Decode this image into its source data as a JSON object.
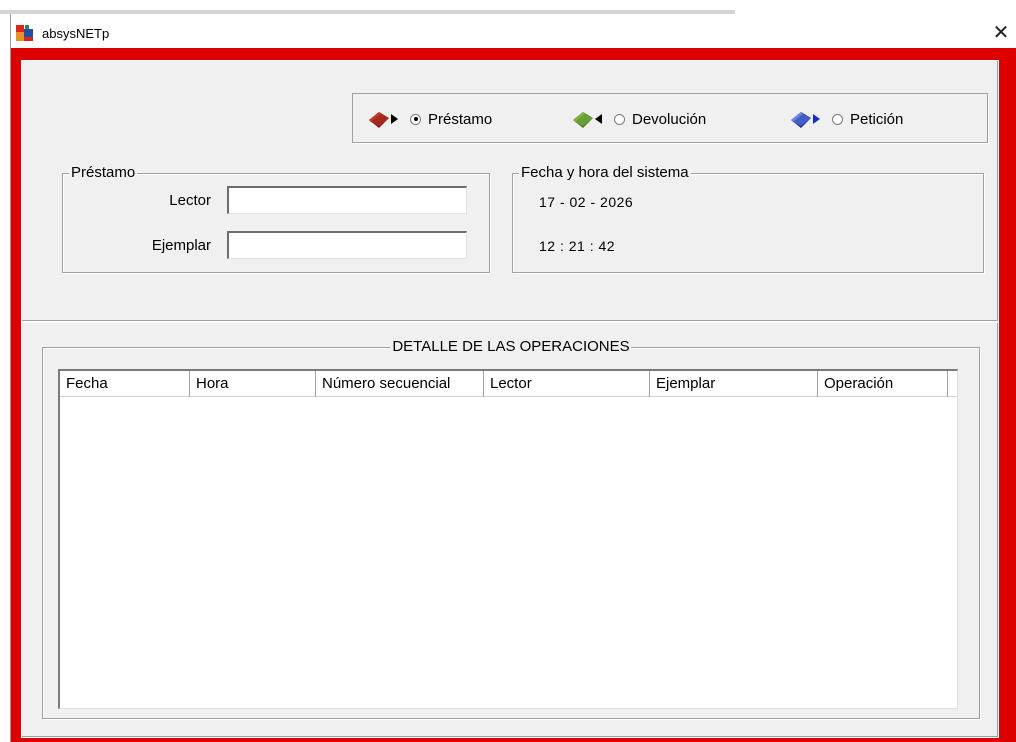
{
  "window": {
    "title": "absysNETp",
    "close_glyph": "✕"
  },
  "mode": {
    "options": [
      {
        "label": "Préstamo",
        "checked": true,
        "icon": "book-red-arrow-icon"
      },
      {
        "label": "Devolución",
        "checked": false,
        "icon": "book-green-arrow-icon"
      },
      {
        "label": "Petición",
        "checked": false,
        "icon": "book-blue-arrow-icon"
      }
    ]
  },
  "prestamo": {
    "title": "Préstamo",
    "lector_label": "Lector",
    "lector_value": "",
    "ejemplar_label": "Ejemplar",
    "ejemplar_value": ""
  },
  "sistema": {
    "title": "Fecha y hora del sistema",
    "date": "17 - 02 - 2026",
    "time": "12 : 21 : 42"
  },
  "detalle": {
    "title": "DETALLE DE LAS OPERACIONES",
    "columns": [
      "Fecha",
      "Hora",
      "Número secuencial",
      "Lector",
      "Ejemplar",
      "Operación"
    ],
    "rows": []
  },
  "colors": {
    "frame_red": "#dc0000",
    "panel_gray": "#f0f0f0"
  }
}
